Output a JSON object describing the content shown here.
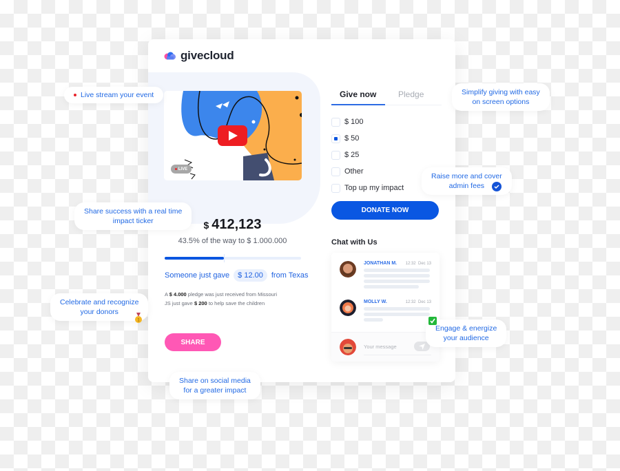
{
  "brand": {
    "name": "givecloud",
    "accent": "#0a57e2",
    "pink": "#ff58b5"
  },
  "video": {
    "live_label": "LIVE"
  },
  "ticker": {
    "currency": "$",
    "total": "412,123",
    "goal_text": "43.5% of the way to $ 1.000.000",
    "progress_percent": 43.5,
    "recent_prefix": "Someone just gave",
    "recent_amount": "$ 12.00",
    "recent_suffix": "from Texas",
    "feed": [
      {
        "pre": "A ",
        "bold": "$ 4.000",
        "post": " pledge was just received from Missouri"
      },
      {
        "pre": "JS just gave ",
        "bold": "$ 200",
        "post": " to help save the children"
      }
    ],
    "share_label": "SHARE"
  },
  "donation": {
    "tabs": [
      {
        "label": "Give now",
        "active": true
      },
      {
        "label": "Pledge",
        "active": false
      }
    ],
    "options": [
      {
        "label": "$ 100",
        "checked": false
      },
      {
        "label": "$ 50",
        "checked": true
      },
      {
        "label": "$ 25",
        "checked": false
      },
      {
        "label": "Other",
        "checked": false
      },
      {
        "label": "Top up my impact",
        "checked": false
      }
    ],
    "donate_label": "DONATE NOW"
  },
  "chat": {
    "title": "Chat with Us",
    "messages": [
      {
        "name": "JONATHAN M.",
        "time": "12:32",
        "date": "Dec 13"
      },
      {
        "name": "MOLLY W.",
        "time": "12:32",
        "date": "Dec 13"
      }
    ],
    "input_placeholder": "Your message"
  },
  "callouts": {
    "live_stream": "Live stream your event",
    "ticker_1": "Share success with a real time",
    "ticker_2": "impact ticker",
    "celebrate_1": "Celebrate and recognize",
    "celebrate_2": "your donors",
    "social_1": "Share on social media",
    "social_2": "for a greater impact",
    "simplify_1": "Simplify giving with easy",
    "simplify_2": "on screen options",
    "raise_1": "Raise more and cover",
    "raise_2": "admin fees",
    "engage_1": "Engage & energize",
    "engage_2": "your audience"
  }
}
